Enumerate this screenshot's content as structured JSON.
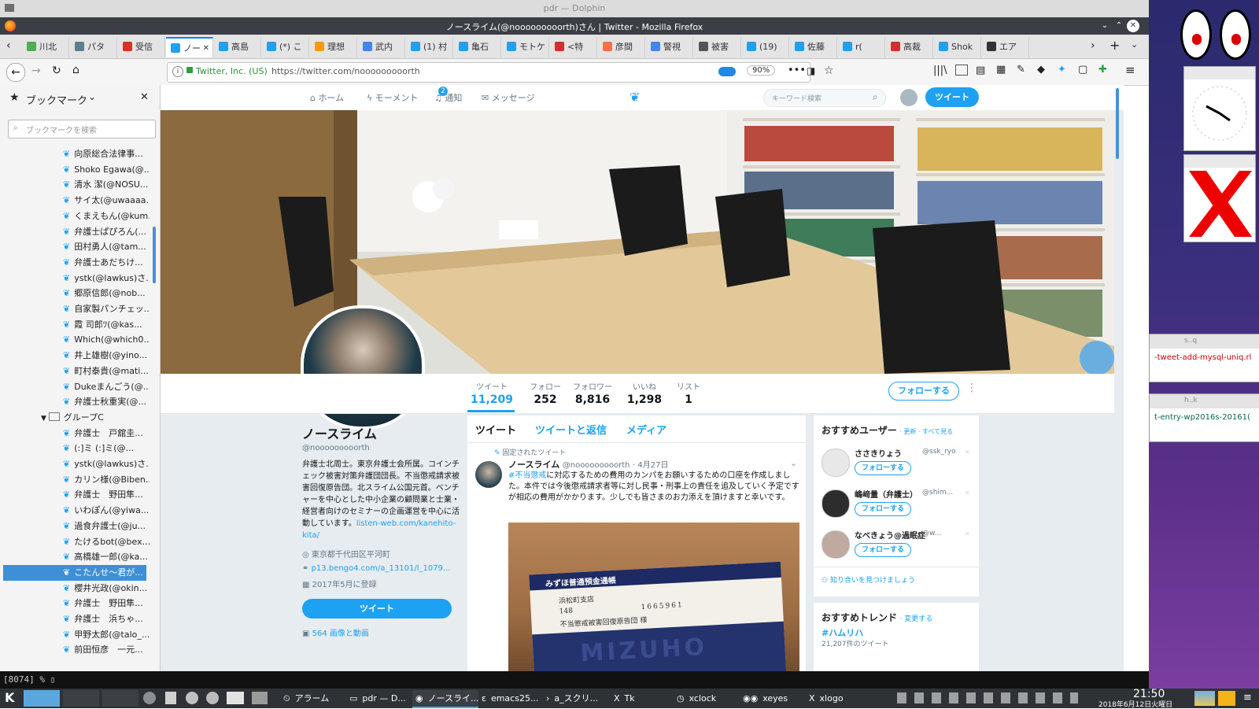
{
  "outer_window": {
    "title": "pdr — Dolphin"
  },
  "browser": {
    "title": "ノースライム(@nooooooooorth)さん | Twitter - Mozilla Firefox",
    "tabs": [
      {
        "label": "川北",
        "color": "#4caf50"
      },
      {
        "label": "パタ",
        "color": "#607d8b"
      },
      {
        "label": "受信",
        "color": "#d93025"
      },
      {
        "label": "ノー",
        "color": "#1da1f2"
      },
      {
        "label": "高島",
        "color": "#1da1f2"
      },
      {
        "label": "(*) こ",
        "color": "#1da1f2"
      },
      {
        "label": "理想",
        "color": "#ff9800"
      },
      {
        "label": "武内",
        "color": "#4285f4"
      },
      {
        "label": "(1) 村",
        "color": "#1da1f2"
      },
      {
        "label": "亀石",
        "color": "#1da1f2"
      },
      {
        "label": "モトケ",
        "color": "#1da1f2"
      },
      {
        "label": "<特",
        "color": "#d32f2f"
      },
      {
        "label": "彦間",
        "color": "#ff7043"
      },
      {
        "label": "警視",
        "color": "#4285f4"
      },
      {
        "label": "被害",
        "color": "#555555"
      },
      {
        "label": "(19)",
        "color": "#1da1f2"
      },
      {
        "label": "佐藤",
        "color": "#1da1f2"
      },
      {
        "label": "r(",
        "color": "#1da1f2"
      },
      {
        "label": "高裁",
        "color": "#d32f2f"
      },
      {
        "label": "Shok",
        "color": "#1da1f2"
      },
      {
        "label": "エア",
        "color": "#333333"
      }
    ],
    "site_identity": "Twitter, Inc. (US)",
    "url": "https://twitter.com/nooooooooorth",
    "zoom": "90%"
  },
  "sidebar": {
    "title": "ブックマーク",
    "search_placeholder": "ブックマークを検索",
    "items": [
      "向原総合法律事...",
      "Shoko Egawa(@...",
      "清水 潔(@NOSU...",
      "サイ太(@uwaaaa...",
      "くまえもん(@kum...",
      "弁護士ぱぴろん(...",
      "田村勇人(@tam...",
      "弁護士あだちけ...",
      "ystk(@lawkus)さ...",
      "郷原信郎(@nob...",
      "自家製パンチェッ...",
      "霞 司郎ﾂ(@kas...",
      "Which(@which0...",
      "井上雄樹(@yino...",
      "町村泰貴(@mati...",
      "Dukeまんごう(@...",
      "弁護士秋重実(@..."
    ],
    "group_label": "グループC",
    "group_items": [
      "弁護士　戸舘圭...",
      "(:]ミ (:]ミ(@...",
      "ystk(@lawkus)さ...",
      "カリン様(@Biben...",
      "弁護士　野田隼...",
      "いわぽん(@yiwa...",
      "過食弁護士(@ju...",
      "たけるbot(@bex...",
      "高橋雄一郎(@ka...",
      "こたんせ〜君が...",
      "櫻井光政(@okin...",
      "弁護士　野田隼...",
      "弁護士　浜ちゃ...",
      "甲野太郎(@talo_...",
      "前田恒彦　一元..."
    ]
  },
  "twitter": {
    "nav": {
      "home": "ホーム",
      "moments": "モーメント",
      "notifications": "通知",
      "notif_badge": "2",
      "messages": "メッセージ"
    },
    "search_placeholder": "キーワード検索",
    "tweet_button": "ツイート",
    "stats": [
      {
        "label": "ツイート",
        "value": "11,209"
      },
      {
        "label": "フォロー",
        "value": "252"
      },
      {
        "label": "フォロワー",
        "value": "8,816"
      },
      {
        "label": "いいね",
        "value": "1,298"
      },
      {
        "label": "リスト",
        "value": "1"
      }
    ],
    "follow_button": "フォローする",
    "profile": {
      "name": "ノースライム",
      "handle": "@nooooooooorth",
      "bio": "弁護士北周士。東京弁護士会所属。コインチェック被害対策弁護団団長。不当懲戒請求被害回復原告団。北スライム公国元首。ベンチャーを中心とした中小企業の顧問業と士業・経営者向けのセミナーの企画運営を中心に活動しています。",
      "bio_link": "listen-web.com/kanehito-kita/",
      "location": "東京都千代田区平河町",
      "website": "p13.bengo4.com/a_13101/l_1079...",
      "joined": "2017年5月に登録",
      "tweet_button": "ツイート",
      "media_link": "564 画像と動画"
    },
    "timeline_tabs": [
      "ツイート",
      "ツイートと返信",
      "メディア"
    ],
    "pinned_label": "固定されたツイート",
    "tweet": {
      "name": "ノースライム",
      "handle": "@nooooooooorth",
      "date": "· 4月27日",
      "hashtag": "#不当懲戒",
      "text": "に対応するための費用のカンパをお願いするための口座を作成しました。本件では今後懲戒請求者等に対し民事・刑事上の責任を追及していく予定ですが相応の費用がかかります。少しでも皆さまのお力添えを頂けますと幸いです。",
      "image_lines": [
        "みずほ普通預金通帳",
        "浜松町支店",
        "148",
        "1665961",
        "不当懲戒被害回復原告団 様",
        "MIZUHO"
      ]
    },
    "recommend": {
      "title": "おすすめユーザー",
      "links": "· 更新 · すべて見る",
      "users": [
        {
          "name": "ささきりょう",
          "handle": "@ssk_ryo"
        },
        {
          "name": "嶋﨑量（弁護士）",
          "handle": "@shim..."
        },
        {
          "name": "なべきょう@過眠症",
          "handle": "@w..."
        }
      ],
      "follow": "フォローする",
      "find_friends": "知り合いを見つけましょう"
    },
    "trends": {
      "title": "おすすめトレンド",
      "change": "· 変更する",
      "items": [
        {
          "tag": "#ハムリハ",
          "count": "21,207件のツイート"
        }
      ]
    }
  },
  "desktop": {
    "mini_windows": [
      {
        "title": "s..q",
        "content": "-tweet-add-mysql-uniq.rl"
      },
      {
        "title": "h..k",
        "content": "t-entry-wp2016s-20161("
      }
    ]
  },
  "terminal": {
    "text": "[8074]  %  ▯"
  },
  "taskbar": {
    "tasks": [
      "アラーム",
      "pdr — D...",
      "ノースライ...",
      "emacs25...",
      "a_スクリ...",
      "Tk",
      "xclock",
      "xeyes",
      "xlogo"
    ],
    "time": "21:50",
    "date": "2018年6月12日火曜日"
  }
}
